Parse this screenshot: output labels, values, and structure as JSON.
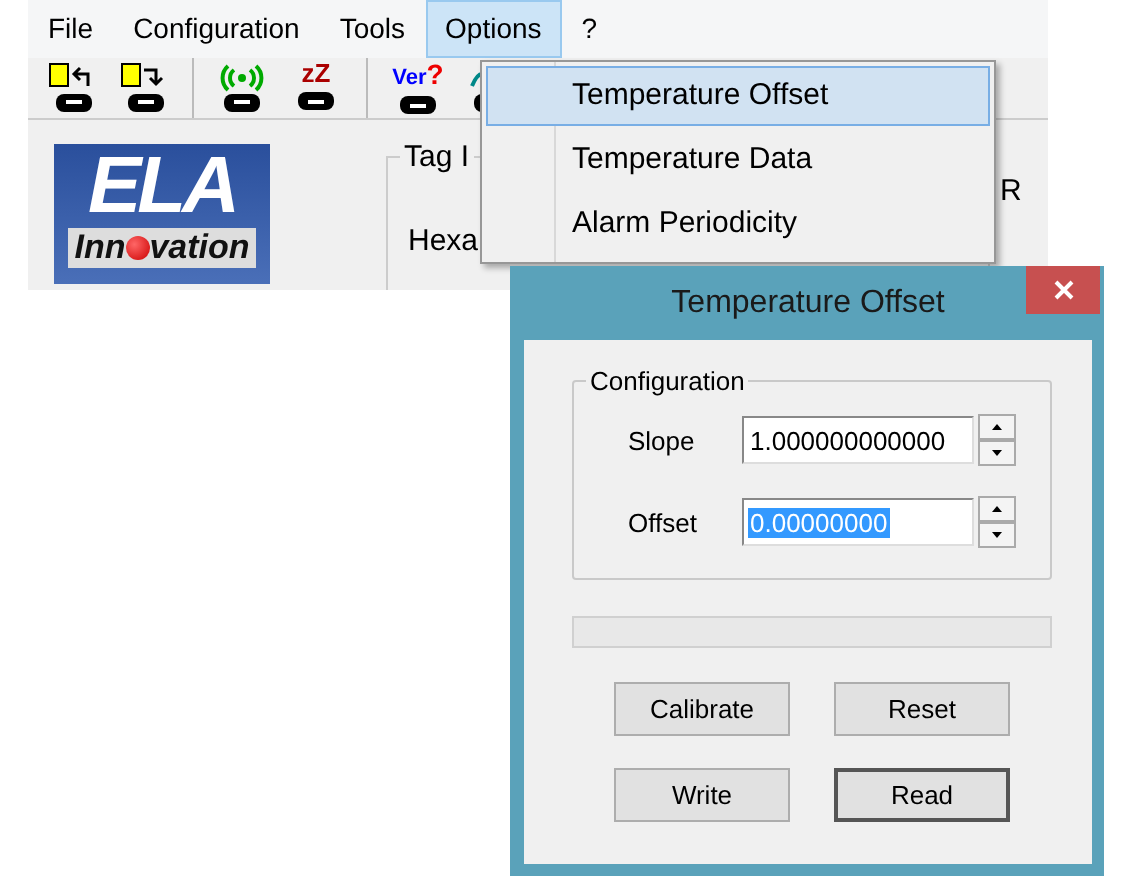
{
  "menu_bar": [
    {
      "label": "File",
      "selected": false
    },
    {
      "label": "Configuration",
      "selected": false
    },
    {
      "label": "Tools",
      "selected": false
    },
    {
      "label": "Options",
      "selected": true
    },
    {
      "label": "?",
      "selected": false
    }
  ],
  "toolbar": [
    [
      {
        "kind": "doc-left"
      },
      {
        "kind": "doc-right"
      }
    ],
    [
      {
        "kind": "wireless"
      },
      {
        "kind": "sleep",
        "label": "zZ"
      }
    ],
    [
      {
        "kind": "version",
        "label": "Ver",
        "mark": "?"
      },
      {
        "kind": "wave"
      }
    ]
  ],
  "logo": {
    "title": "ELA",
    "subtitle_start": "Inn",
    "subtitle_end": "vation"
  },
  "tag_group": {
    "title": "Tag I",
    "row_label": "Hexa",
    "column_label": "R"
  },
  "dropdown": {
    "items": [
      {
        "label": "Temperature Offset",
        "selected": true
      },
      {
        "label": "Temperature Data",
        "selected": false
      },
      {
        "label": "Alarm Periodicity",
        "selected": false
      }
    ]
  },
  "dialog": {
    "title": "Temperature Offset",
    "group_title": "Configuration",
    "progress": {
      "level": 0
    },
    "fields": [
      {
        "label": "Slope",
        "value": "1.000000000000",
        "selected": false
      },
      {
        "label": "Offset",
        "value": "0.00000000",
        "selected": true
      }
    ],
    "buttons": [
      {
        "label": "Calibrate",
        "default": false
      },
      {
        "label": "Reset",
        "default": false
      },
      {
        "label": "Write",
        "default": false
      },
      {
        "label": "Read",
        "default": true
      }
    ]
  }
}
